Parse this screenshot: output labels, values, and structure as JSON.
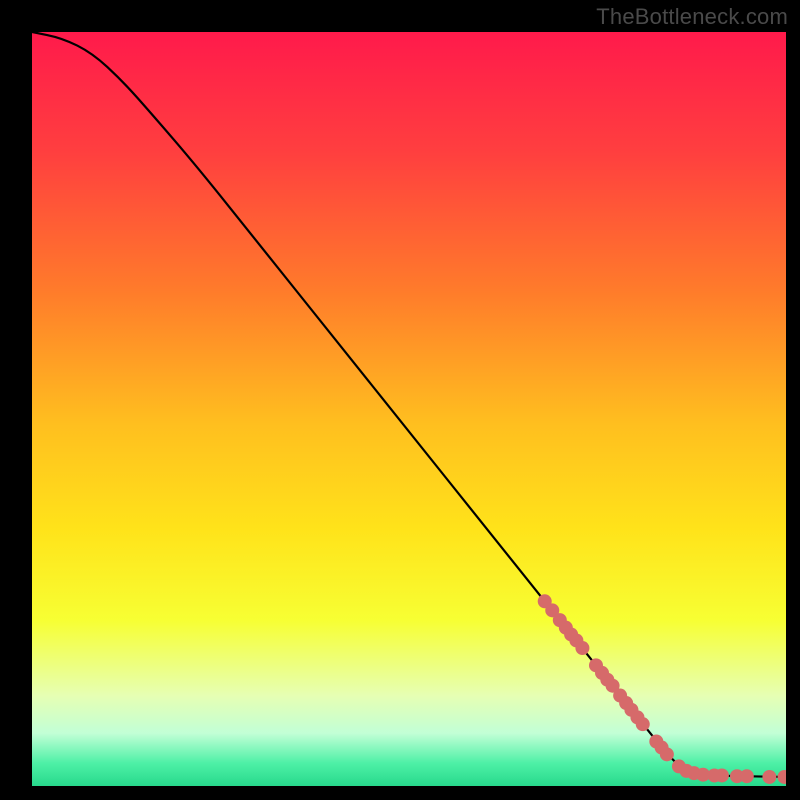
{
  "watermark": "TheBottleneck.com",
  "chart_data": {
    "type": "line",
    "title": "",
    "xlabel": "",
    "ylabel": "",
    "xlim": [
      0,
      100
    ],
    "ylim": [
      0,
      100
    ],
    "gradient_stops": [
      {
        "offset": 0.0,
        "color": "#ff1a4b"
      },
      {
        "offset": 0.16,
        "color": "#ff3f3f"
      },
      {
        "offset": 0.34,
        "color": "#ff7a2b"
      },
      {
        "offset": 0.52,
        "color": "#ffbf1f"
      },
      {
        "offset": 0.66,
        "color": "#ffe31a"
      },
      {
        "offset": 0.78,
        "color": "#f7ff33"
      },
      {
        "offset": 0.88,
        "color": "#e6ffb3"
      },
      {
        "offset": 0.93,
        "color": "#c2ffd6"
      },
      {
        "offset": 0.97,
        "color": "#4df0a6"
      },
      {
        "offset": 1.0,
        "color": "#28d98c"
      }
    ],
    "curve": [
      {
        "x": 0,
        "y": 100
      },
      {
        "x": 4,
        "y": 99.2
      },
      {
        "x": 8,
        "y": 97.2
      },
      {
        "x": 12,
        "y": 93.5
      },
      {
        "x": 16,
        "y": 89.0
      },
      {
        "x": 22,
        "y": 82.0
      },
      {
        "x": 30,
        "y": 72.0
      },
      {
        "x": 40,
        "y": 59.5
      },
      {
        "x": 50,
        "y": 47.0
      },
      {
        "x": 60,
        "y": 34.5
      },
      {
        "x": 68,
        "y": 24.5
      },
      {
        "x": 74,
        "y": 17.0
      },
      {
        "x": 80,
        "y": 9.5
      },
      {
        "x": 84,
        "y": 4.5
      },
      {
        "x": 86,
        "y": 2.5
      },
      {
        "x": 88,
        "y": 1.6
      },
      {
        "x": 90,
        "y": 1.4
      },
      {
        "x": 94,
        "y": 1.3
      },
      {
        "x": 100,
        "y": 1.2
      }
    ],
    "highlight_points": [
      {
        "x": 68.0,
        "y": 24.5
      },
      {
        "x": 69.0,
        "y": 23.3
      },
      {
        "x": 70.0,
        "y": 22.0
      },
      {
        "x": 70.8,
        "y": 21.0
      },
      {
        "x": 71.5,
        "y": 20.1
      },
      {
        "x": 72.2,
        "y": 19.3
      },
      {
        "x": 73.0,
        "y": 18.3
      },
      {
        "x": 74.8,
        "y": 16.0
      },
      {
        "x": 75.6,
        "y": 15.0
      },
      {
        "x": 76.3,
        "y": 14.1
      },
      {
        "x": 77.0,
        "y": 13.3
      },
      {
        "x": 78.0,
        "y": 12.0
      },
      {
        "x": 78.8,
        "y": 11.0
      },
      {
        "x": 79.5,
        "y": 10.1
      },
      {
        "x": 80.3,
        "y": 9.1
      },
      {
        "x": 81.0,
        "y": 8.2
      },
      {
        "x": 82.8,
        "y": 5.9
      },
      {
        "x": 83.5,
        "y": 5.1
      },
      {
        "x": 84.2,
        "y": 4.2
      },
      {
        "x": 85.8,
        "y": 2.6
      },
      {
        "x": 86.8,
        "y": 2.0
      },
      {
        "x": 87.8,
        "y": 1.7
      },
      {
        "x": 89.0,
        "y": 1.5
      },
      {
        "x": 90.5,
        "y": 1.4
      },
      {
        "x": 91.5,
        "y": 1.4
      },
      {
        "x": 93.5,
        "y": 1.3
      },
      {
        "x": 94.8,
        "y": 1.3
      },
      {
        "x": 97.8,
        "y": 1.2
      },
      {
        "x": 99.8,
        "y": 1.2
      }
    ],
    "highlight_color": "#d66a6a",
    "curve_color": "#000000"
  }
}
